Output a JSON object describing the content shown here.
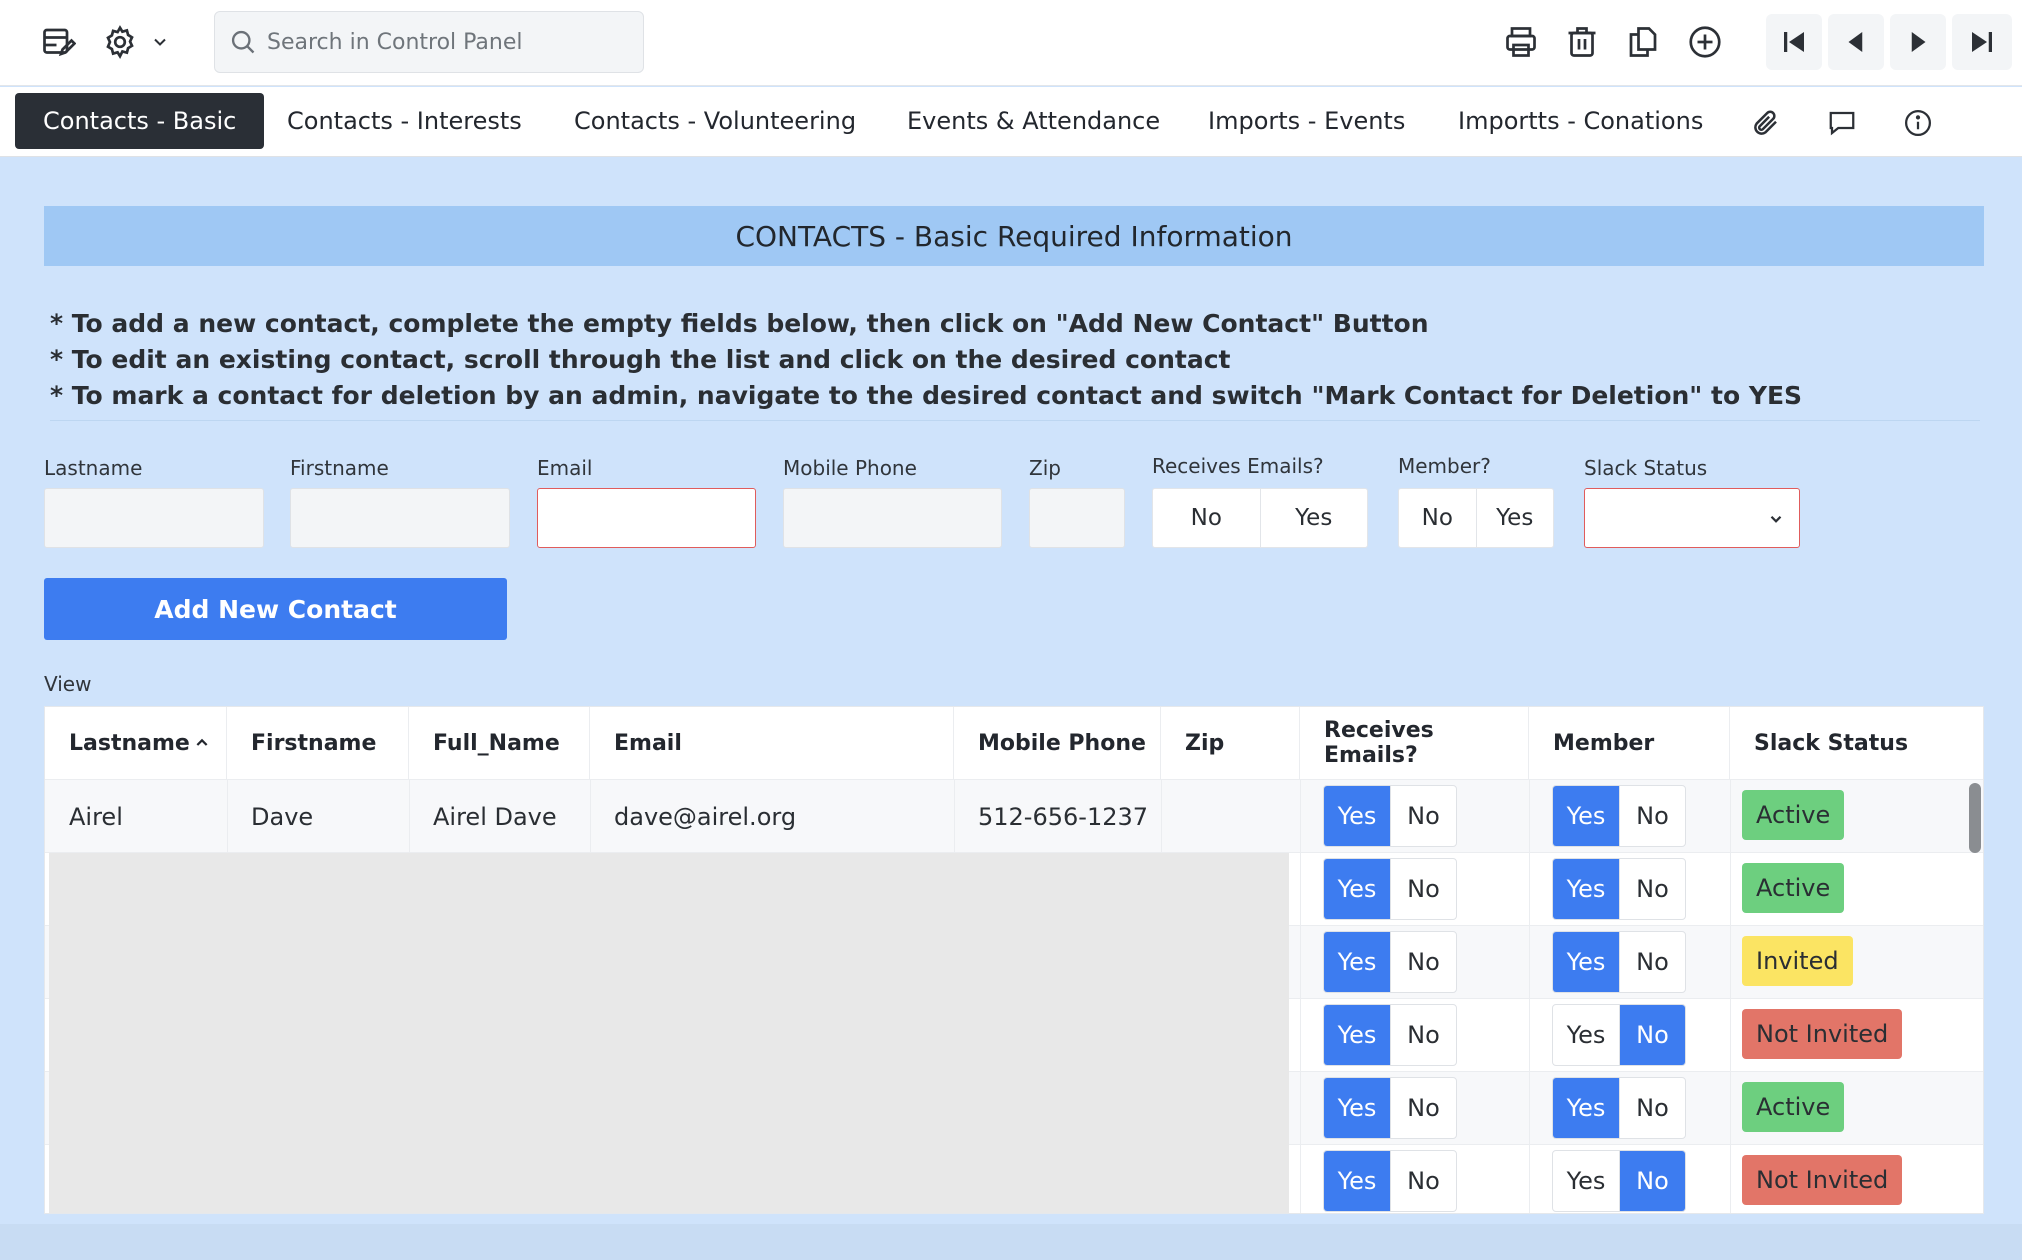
{
  "toolbar": {
    "search_placeholder": "Search in Control Panel",
    "icons": [
      "edit-table-icon",
      "gear-icon",
      "chevron-down-icon",
      "print-icon",
      "trash-icon",
      "copy-icon",
      "add-icon",
      "first-record-icon",
      "prev-record-icon",
      "next-record-icon",
      "last-record-icon"
    ]
  },
  "tabs": [
    {
      "label": "Contacts - Basic",
      "active": true
    },
    {
      "label": "Contacts - Interests"
    },
    {
      "label": "Contacts - Volunteering"
    },
    {
      "label": "Events & Attendance"
    },
    {
      "label": "Imports - Events"
    },
    {
      "label": "Importts - Conations"
    }
  ],
  "tab_icons": [
    "paperclip-icon",
    "comment-icon",
    "info-icon"
  ],
  "banner": "CONTACTS - Basic Required Information",
  "instructions": [
    "* To add a new contact, complete the empty fields below, then click on \"Add New Contact\" Button",
    "* To edit an existing contact, scroll through the list and click on the desired contact",
    "* To mark a contact for deletion by an admin, navigate to the desired contact and switch \"Mark Contact for Deletion\" to YES"
  ],
  "form": {
    "lastname_label": "Lastname",
    "firstname_label": "Firstname",
    "email_label": "Email",
    "mobile_label": "Mobile Phone",
    "zip_label": "Zip",
    "receives_label": "Receives Emails?",
    "member_label": "Member?",
    "slack_label": "Slack Status",
    "no": "No",
    "yes": "Yes",
    "lastname_value": "",
    "firstname_value": "",
    "email_value": "",
    "mobile_value": "",
    "zip_value": "",
    "slack_value": ""
  },
  "add_button": "Add New Contact",
  "view_label": "View",
  "table": {
    "headers": [
      "Lastname",
      "Firstname",
      "Full_Name",
      "Email",
      "Mobile Phone",
      "Zip",
      "Receives Emails?",
      "Member",
      "Slack Status"
    ],
    "yes": "Yes",
    "no": "No",
    "rows": [
      {
        "lastname": "Airel",
        "firstname": "Dave",
        "full_name": "Airel Dave",
        "email": "dave@airel.org",
        "mobile": "512-656-1237",
        "zip": "",
        "receives": "Yes",
        "member": "Yes",
        "slack": "Active"
      },
      {
        "receives": "Yes",
        "member": "Yes",
        "slack": "Active"
      },
      {
        "receives": "Yes",
        "member": "Yes",
        "slack": "Invited"
      },
      {
        "receives": "Yes",
        "member": "No",
        "slack": "Not Invited"
      },
      {
        "receives": "Yes",
        "member": "Yes",
        "slack": "Active"
      },
      {
        "receives": "Yes",
        "member": "No",
        "slack": "Not Invited"
      }
    ]
  },
  "colors": {
    "accent": "#3d7cf0",
    "active": "#6dcf7f",
    "invited": "#fbe463",
    "not_invited": "#e27568",
    "banner": "#9fc8f4",
    "background": "#cfe3fb"
  }
}
